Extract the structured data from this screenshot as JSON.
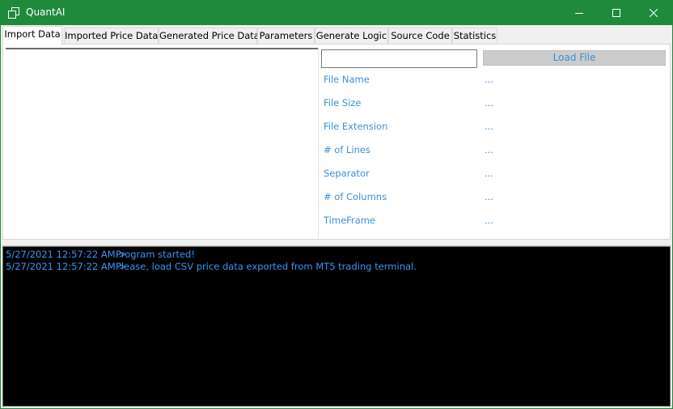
{
  "window": {
    "title": "QuantAI",
    "title_bar_color": "#1f8a3b",
    "icon": "app-window-icon",
    "controls": [
      "minimize-icon",
      "maximize-icon",
      "close-icon"
    ]
  },
  "tabs": [
    {
      "label": "Import Data",
      "active": true
    },
    {
      "label": "Imported Price Data",
      "active": false
    },
    {
      "label": "Generated Price Data",
      "active": false
    },
    {
      "label": "Parameters",
      "active": false
    },
    {
      "label": "Generate Logic",
      "active": false
    },
    {
      "label": "Source Code",
      "active": false
    },
    {
      "label": "Statistics",
      "active": false
    }
  ],
  "import": {
    "path_value": "",
    "load_label": "Load File",
    "info": [
      {
        "label": "File Name",
        "value": "..."
      },
      {
        "label": "File Size",
        "value": "..."
      },
      {
        "label": "File Extension",
        "value": "..."
      },
      {
        "label": "# of Lines",
        "value": "..."
      },
      {
        "label": "Separator",
        "value": "..."
      },
      {
        "label": "# of Columns",
        "value": "..."
      },
      {
        "label": "TimeFrame",
        "value": "..."
      }
    ]
  },
  "log": {
    "text_color": "#3a95f0",
    "background": "#000000",
    "entries": [
      {
        "timestamp": "5/27/2021 12:57:22 AM >",
        "message": "Program started!"
      },
      {
        "timestamp": "5/27/2021 12:57:22 AM >",
        "message": "Please, load CSV price data exported from MT5 trading terminal."
      }
    ]
  }
}
